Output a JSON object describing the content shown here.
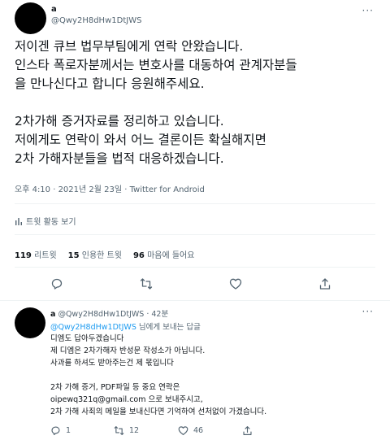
{
  "tweet": {
    "display_name": "a",
    "handle": "@Qwy2H8dHw1DtJWS",
    "body_lines": [
      "저이겐 큐브 법무부팀에게 연락 안왔습니다.",
      "인스타 폭로자분께서는 변호사를 대동하여 관계자분들",
      "을 만나신다고 합니다 응원해주세요.",
      "",
      "2차가해 증거자료를 정리하고 있습니다.",
      "저에게도 연락이 와서 어느 결론이든 확실해지면",
      "2차 가해자분들을 법적 대응하겠습니다."
    ],
    "timestamp": "오후 4:10 · 2021년 2월 23일 · Twitter for Android",
    "activity_label": "트윗 활동 보기",
    "stats": {
      "retweets_count": "119",
      "retweets_label": "리트윗",
      "quotes_count": "15",
      "quotes_label": "인용한 트윗",
      "likes_count": "96",
      "likes_label": "마음에 들어요"
    }
  },
  "reply": {
    "display_name": "a",
    "handle": "@Qwy2H8dHw1DtJWS",
    "time": "· 42분",
    "reply_to_handle": "@Qwy2H8dHw1DtJWS",
    "reply_to_suffix": "님에게 보내는 답글",
    "body_lines": [
      "디엠도 답아두겠습니다",
      "제 디엠은 2차가해자 반성문 작성소가 아닙니다.",
      "사과를 하셔도 받아주는건 제 몫입니다",
      "",
      "2차 가해 증거, PDF파일 등 중요 연락은",
      "oipewq321q@gmail.com 으로 보내주시고,",
      "2차 가해 사죄의 메일을 보내신다면 기억하여 선처없이 가겠습니다."
    ],
    "reply_count": "1",
    "retweet_count": "12",
    "like_count": "46"
  },
  "colors": {
    "text": "#0f1419",
    "muted": "#536471",
    "link": "#1d9bf0",
    "divider": "#eff3f4"
  }
}
